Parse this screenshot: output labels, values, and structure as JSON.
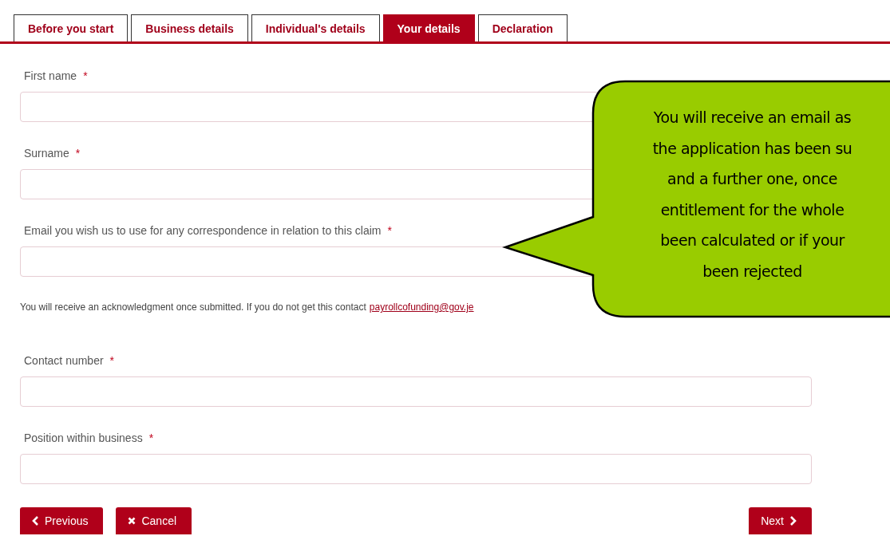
{
  "tabs": [
    {
      "label": "Before you start",
      "selected": false
    },
    {
      "label": "Business details",
      "selected": false
    },
    {
      "label": "Individual's details",
      "selected": false
    },
    {
      "label": "Your details",
      "selected": true
    },
    {
      "label": "Declaration",
      "selected": false
    }
  ],
  "fields_top": [
    {
      "label": "First name",
      "required_mark": "*"
    },
    {
      "label": "Surname",
      "required_mark": "*"
    },
    {
      "label": "Email you wish us to use for any correspondence in relation to this claim",
      "required_mark": "*"
    }
  ],
  "note": {
    "text": "You will receive an acknowledgment once submitted. If you do not get this contact",
    "link": "payrollcofunding@gov.je"
  },
  "fields_bottom": [
    {
      "label": "Contact number",
      "required_mark": "*"
    },
    {
      "label": "Position within business",
      "required_mark": "*"
    }
  ],
  "buttons": [
    {
      "label": "Previous",
      "kind": "previous"
    },
    {
      "label": "Cancel",
      "kind": "cancel"
    },
    {
      "label": "Next",
      "kind": "next"
    }
  ],
  "callout": {
    "lines": [
      "You will receive an email as",
      "the application has been su",
      "and a further one, once",
      "entitlement for the whole",
      "been calculated or if your",
      "been rejected"
    ]
  }
}
